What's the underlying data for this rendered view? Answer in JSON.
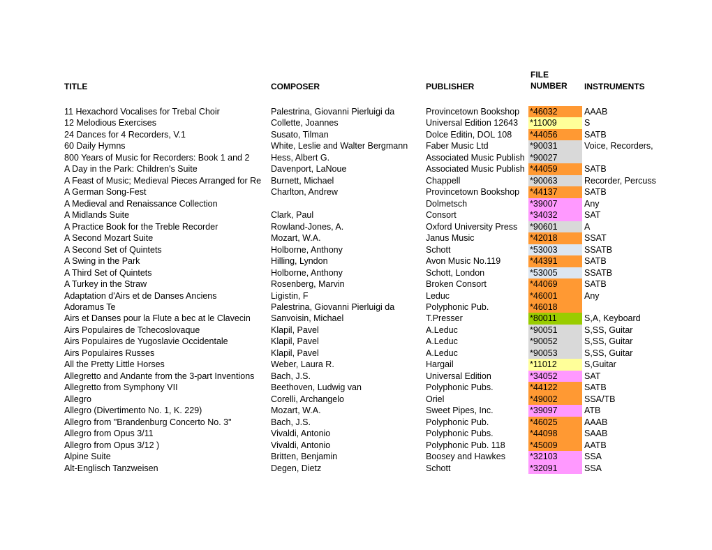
{
  "headers": {
    "title": "TITLE",
    "composer": "COMPOSER",
    "publisher": "PUBLISHER",
    "file_line1": "FILE",
    "file_line2": "NUMBER",
    "instruments": "INSTRUMENTS"
  },
  "colors": {
    "orange": "#FF9933",
    "yellow": "#FFFF99",
    "gray": "#D9D9D9",
    "pink": "#FF99FF",
    "lightblue": "#DCE6F1",
    "green": "#99CC00"
  },
  "rows": [
    {
      "title": "11 Hexachord Vocalises for Trebal Choir",
      "composer": "Palestrina, Giovanni Pierluigi da",
      "publisher": "Provincetown Bookshop",
      "file": "*46032",
      "color": "orange",
      "instruments": "AAAB"
    },
    {
      "title": "12 Melodious Exercises",
      "composer": "Collette, Joannes",
      "publisher": "Universal Edition 12643",
      "file": "*11009",
      "color": "yellow",
      "instruments": "S"
    },
    {
      "title": "24 Dances for 4 Recorders, V.1",
      "composer": "Susato, Tilman",
      "publisher": "Dolce Editin, DOL 108",
      "file": "*44056",
      "color": "orange",
      "instruments": "SATB"
    },
    {
      "title": "60 Daily Hymns",
      "composer": "White, Leslie and Walter Bergmann",
      "publisher": "Faber Music Ltd",
      "file": "*90031",
      "color": "gray",
      "instruments": "Voice, Recorders,"
    },
    {
      "title": "800 Years of Music for Recorders: Book 1 and 2",
      "composer": "Hess, Albert G.",
      "publisher": "Associated Music Publish",
      "file": "*90027",
      "color": "gray",
      "instruments": ""
    },
    {
      "title": "A Day in the Park: Children's Suite",
      "composer": "Davenport, LaNoue",
      "publisher": "Associated Music Publish",
      "file": "*44059",
      "color": "orange",
      "instruments": "SATB"
    },
    {
      "title": "A Feast of Music; Medieval Pieces Arranged for Re",
      "composer": "Burnett, Michael",
      "publisher": "Chappell",
      "file": "*90063",
      "color": "gray",
      "instruments": "Recorder, Percuss"
    },
    {
      "title": "A German Song-Fest",
      "composer": "Charlton, Andrew",
      "publisher": "Provincetown Bookshop",
      "file": "*44137",
      "color": "orange",
      "instruments": "SATB"
    },
    {
      "title": "A Medieval and Renaissance Collection",
      "composer": "",
      "publisher": "Dolmetsch",
      "file": "*39007",
      "color": "pink",
      "instruments": "Any"
    },
    {
      "title": "A Midlands Suite",
      "composer": "Clark, Paul",
      "publisher": "Consort",
      "file": "*34032",
      "color": "pink",
      "instruments": "SAT"
    },
    {
      "title": "A Practice Book for the Treble Recorder",
      "composer": "Rowland-Jones, A.",
      "publisher": "Oxford University Press",
      "file": "*90601",
      "color": "gray",
      "instruments": "A"
    },
    {
      "title": "A Second Mozart Suite",
      "composer": "Mozart, W.A.",
      "publisher": "Janus Music",
      "file": "*42018",
      "color": "orange",
      "instruments": "SSAT"
    },
    {
      "title": "A Second Set of Quintets",
      "composer": "Holborne, Anthony",
      "publisher": "Schott",
      "file": "*53003",
      "color": "lightblue",
      "instruments": "SSATB"
    },
    {
      "title": "A Swing in the Park",
      "composer": "Hilling, Lyndon",
      "publisher": "Avon Music No.119",
      "file": "*44391",
      "color": "orange",
      "instruments": "SATB"
    },
    {
      "title": "A Third Set of Quintets",
      "composer": "Holborne, Anthony",
      "publisher": "Schott, London",
      "file": "*53005",
      "color": "lightblue",
      "instruments": "SSATB"
    },
    {
      "title": "A Turkey in the Straw",
      "composer": "Rosenberg, Marvin",
      "publisher": "Broken Consort",
      "file": "*44069",
      "color": "orange",
      "instruments": "SATB"
    },
    {
      "title": "Adaptation d'Airs et de Danses Anciens",
      "composer": "Ligistin, F",
      "publisher": "Leduc",
      "file": "*46001",
      "color": "orange",
      "instruments": "Any"
    },
    {
      "title": "Adoramus Te",
      "composer": "Palestrina, Giovanni Pierluigi da",
      "publisher": "Polyphonic Pub.",
      "file": "*46018",
      "color": "orange",
      "instruments": ""
    },
    {
      "title": "Airs et Danses pour la Flute a bec at le Clavecin",
      "composer": "Sanvoisin, Michael",
      "publisher": "T.Presser",
      "file": "*80011",
      "color": "green",
      "instruments": "S,A, Keyboard"
    },
    {
      "title": "Airs Populaires de Tchecoslovaque",
      "composer": "Klapil, Pavel",
      "publisher": "A.Leduc",
      "file": "*90051",
      "color": "gray",
      "instruments": "S,SS, Guitar"
    },
    {
      "title": "Airs Populaires de Yugoslavie Occidentale",
      "composer": "Klapil, Pavel",
      "publisher": "A.Leduc",
      "file": "*90052",
      "color": "gray",
      "instruments": "S,SS, Guitar"
    },
    {
      "title": "Airs Populaires Russes",
      "composer": "Klapil, Pavel",
      "publisher": "A.Leduc",
      "file": "*90053",
      "color": "gray",
      "instruments": "S,SS, Guitar"
    },
    {
      "title": "All the Pretty Little Horses",
      "composer": "Weber, Laura R.",
      "publisher": "Hargail",
      "file": "*11012",
      "color": "yellow",
      "instruments": "S,Guitar"
    },
    {
      "title": "Allegretto and Andante from the 3-part Inventions",
      "composer": "Bach, J.S.",
      "publisher": "Universal Edition",
      "file": "*34052",
      "color": "pink",
      "instruments": "SAT"
    },
    {
      "title": "Allegretto from Symphony VII",
      "composer": "Beethoven, Ludwig van",
      "publisher": "Polyphonic Pubs.",
      "file": "*44122",
      "color": "orange",
      "instruments": "SATB"
    },
    {
      "title": "Allegro",
      "composer": "Corelli, Archangelo",
      "publisher": "Oriel",
      "file": "*49002",
      "color": "orange",
      "instruments": "SSA/TB"
    },
    {
      "title": "Allegro (Divertimento No. 1, K. 229)",
      "composer": "Mozart, W.A.",
      "publisher": "Sweet Pipes, Inc.",
      "file": "*39097",
      "color": "pink",
      "instruments": "ATB"
    },
    {
      "title": "Allegro from \"Brandenburg Concerto No. 3\"",
      "composer": "Bach, J.S.",
      "publisher": "Polyphonic Pub.",
      "file": "*46025",
      "color": "orange",
      "instruments": "AAAB"
    },
    {
      "title": "Allegro from Opus 3/11",
      "composer": "Vivaldi, Antonio",
      "publisher": "Polyphonic Pubs.",
      "file": "*44098",
      "color": "orange",
      "instruments": "SAAB"
    },
    {
      "title": "Allegro from Opus 3/12 )",
      "composer": "Vivaldi, Antonio",
      "publisher": "Polyphonic Pub. 118",
      "file": "*45009",
      "color": "orange",
      "instruments": "AATB"
    },
    {
      "title": "Alpine Suite",
      "composer": "Britten, Benjamin",
      "publisher": "Boosey and Hawkes",
      "file": "*32103",
      "color": "pink",
      "instruments": "SSA"
    },
    {
      "title": "Alt-Englisch Tanzweisen",
      "composer": "Degen, Dietz",
      "publisher": "Schott",
      "file": "*32091",
      "color": "pink",
      "instruments": "SSA"
    }
  ]
}
